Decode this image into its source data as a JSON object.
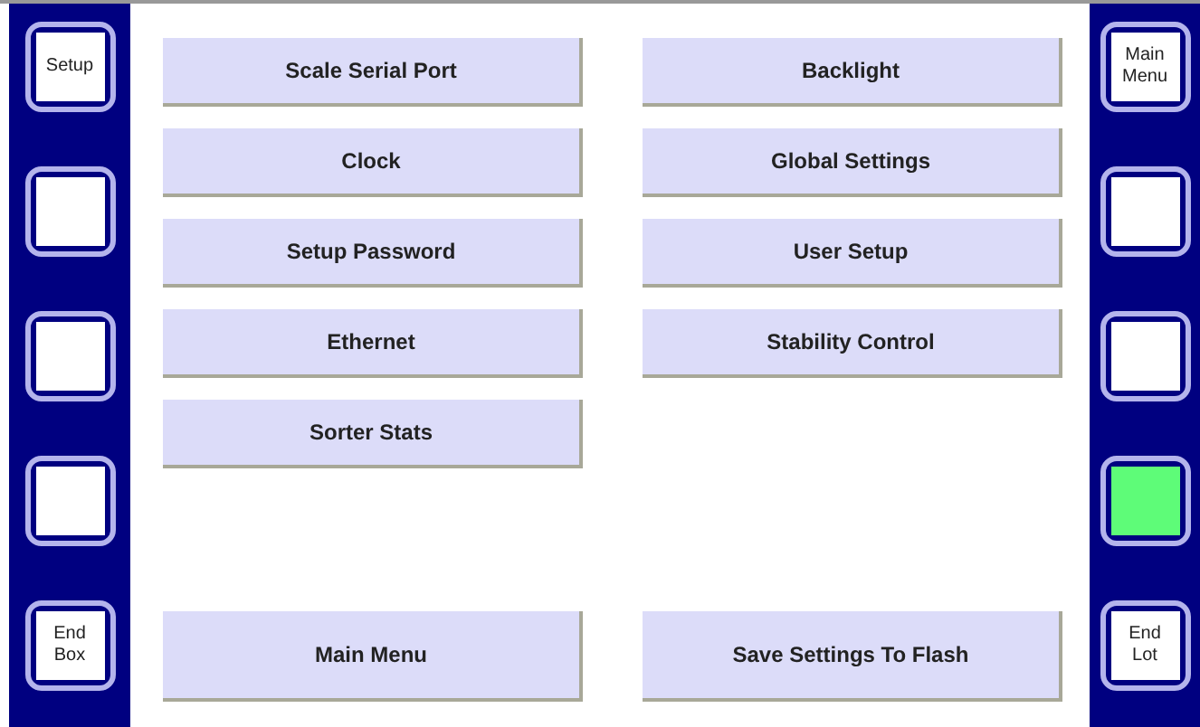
{
  "left_keys": [
    {
      "label": "Setup",
      "lit": false
    },
    {
      "lit": false
    },
    {
      "lit": false
    },
    {
      "lit": false
    },
    {
      "label": "End Box",
      "lit": false
    }
  ],
  "menu_columns": [
    [
      "Scale Serial Port",
      "Clock",
      "Setup Password",
      "Ethernet",
      "Sorter Stats"
    ],
    [
      "Backlight",
      "Global Settings",
      "User Setup",
      "Stability Control"
    ]
  ],
  "bottom_buttons": [
    "Main Menu",
    "Save Settings To Flash"
  ],
  "right_keys": [
    {
      "label": "Main Menu",
      "lit": false
    },
    {
      "lit": false
    },
    {
      "lit": false
    },
    {
      "lit": true
    },
    {
      "label": "End Lot",
      "lit": false
    }
  ]
}
